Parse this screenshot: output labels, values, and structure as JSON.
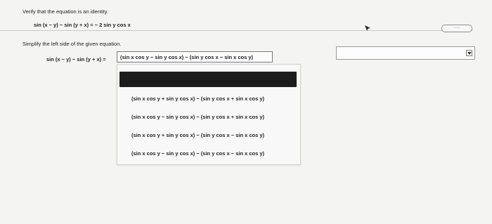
{
  "question": {
    "instruction": "Verify that the equation is an identity.",
    "identity": "sin (x − y) − sin (y + x) = − 2 sin y cos x"
  },
  "more_button": {
    "label": "....."
  },
  "step": {
    "instruction": "Simplify the left side of the given equation.",
    "lhs": "sin (x − y) − sin (y + x) =",
    "selected": "(sin x cos y − sin y cos x) − (sin y cos x − sin x cos y)"
  },
  "dropdown": {
    "highlighted": "",
    "options": [
      "(sin x cos y + sin y cos x) − (sin y cos x + sin x cos y)",
      "(sin x cos y − sin y cos x) − (sin y cos x + sin x cos y)",
      "(sin x cos y + sin y cos x) − (sin y cos x − sin x cos y)",
      "(sin x cos y − sin y cos x) − (sin y cos x − sin x cos y)"
    ]
  },
  "right_select": {
    "value": ""
  },
  "icons": {
    "cursor": "arrow-cursor-icon",
    "dropdown_arrow": "chevron-down-icon"
  }
}
